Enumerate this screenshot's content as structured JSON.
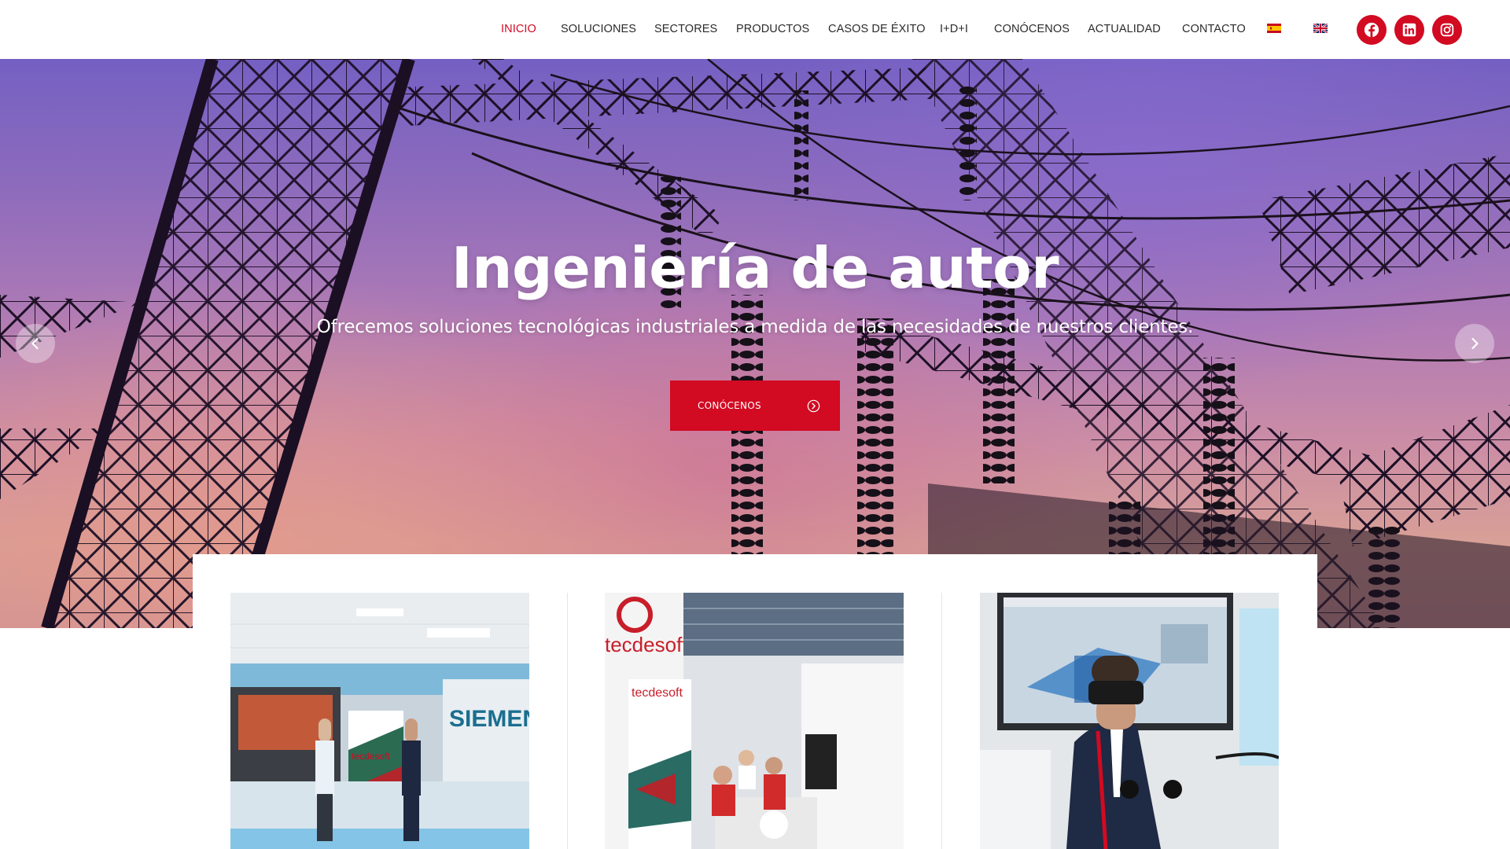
{
  "header": {
    "nav": [
      {
        "label": "INICIO",
        "active": true
      },
      {
        "label": "SOLUCIONES",
        "active": false
      },
      {
        "label": "SECTORES",
        "active": false
      },
      {
        "label": "PRODUCTOS",
        "active": false
      },
      {
        "label": "CASOS DE ÉXITO",
        "active": false
      },
      {
        "label": "I+D+I",
        "active": false
      },
      {
        "label": "CONÓCENOS",
        "active": false
      },
      {
        "label": "ACTUALIDAD",
        "active": false
      },
      {
        "label": "CONTACTO",
        "active": false
      }
    ],
    "languages": [
      {
        "icon": "spain-flag-icon"
      },
      {
        "icon": "uk-flag-icon"
      }
    ],
    "social": [
      {
        "icon": "facebook-icon"
      },
      {
        "icon": "linkedin-icon"
      },
      {
        "icon": "instagram-icon"
      }
    ]
  },
  "hero": {
    "title": "Ingeniería de autor",
    "subtitle": "Ofrecemos soluciones tecnológicas industriales a medida de las necesidades de nuestros clientes.",
    "cta_label": "CONÓCENOS",
    "cta_icon": "arrow-circle-right-icon",
    "prev_icon": "chevron-left-icon",
    "next_icon": "chevron-right-icon",
    "background": "electrical-substation-photo"
  },
  "cards": [
    {
      "image": "siemens-showroom-photo",
      "sign_text": "SIEMEN",
      "banner_text": "tecdesoft"
    },
    {
      "image": "tecdesoft-trade-fair-stand-photo",
      "sign_text": "tecdesoft",
      "banner_text": "tecdesoft"
    },
    {
      "image": "vr-headset-demo-photo"
    }
  ],
  "colors": {
    "accent": "#d20a22",
    "nav_text": "#2b2b2b",
    "white": "#ffffff"
  }
}
